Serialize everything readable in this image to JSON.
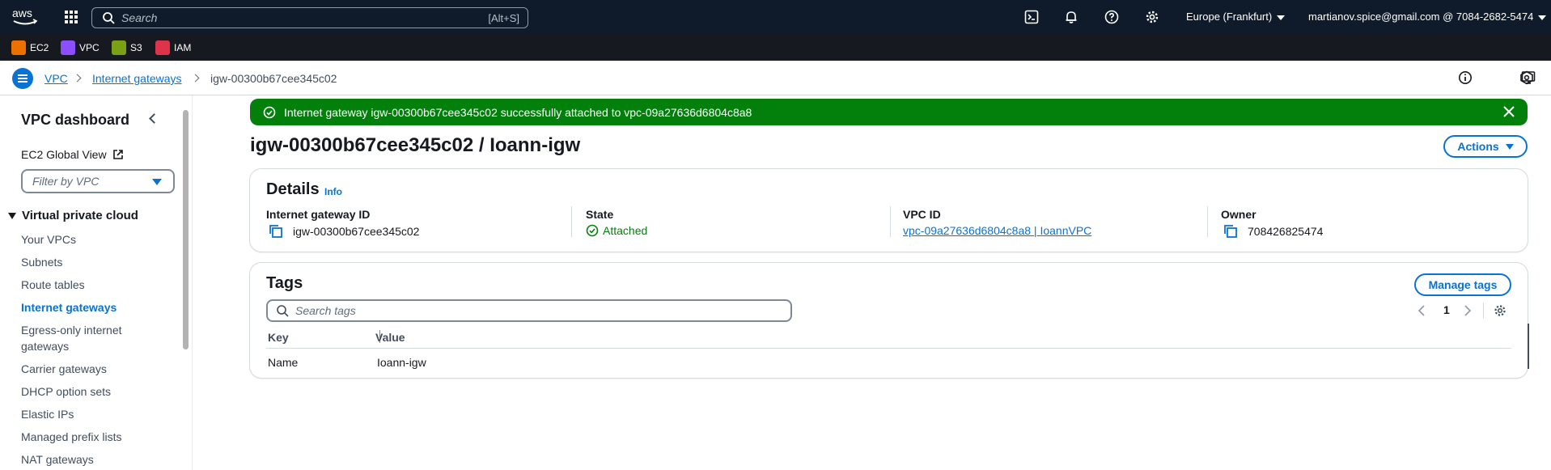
{
  "topnav": {
    "logo_text": "aws",
    "search_placeholder": "Search",
    "search_shortcut": "[Alt+S]",
    "region": "Europe (Frankfurt)",
    "account": "martianov.spice@gmail.com @ 7084-2682-5474"
  },
  "favorites": [
    {
      "label": "EC2",
      "color": "#ed7100"
    },
    {
      "label": "VPC",
      "color": "#8c4fff"
    },
    {
      "label": "S3",
      "color": "#7aa116"
    },
    {
      "label": "IAM",
      "color": "#dd344c"
    }
  ],
  "breadcrumb": {
    "items": [
      "VPC",
      "Internet gateways"
    ],
    "current": "igw-00300b67cee345c02"
  },
  "sidebar": {
    "title": "VPC dashboard",
    "ec2_global_view": "EC2 Global View",
    "filter_placeholder": "Filter by VPC",
    "section": "Virtual private cloud",
    "items": [
      "Your VPCs",
      "Subnets",
      "Route tables",
      "Internet gateways",
      "Egress-only internet",
      "gateways",
      "Carrier gateways",
      "DHCP option sets",
      "Elastic IPs",
      "Managed prefix lists",
      "NAT gateways"
    ]
  },
  "flash": {
    "message": "Internet gateway igw-00300b67cee345c02 successfully attached to vpc-09a27636d6804c8a8",
    "color": "#037f0c"
  },
  "page": {
    "title": "igw-00300b67cee345c02 / Ioann-igw",
    "actions_label": "Actions"
  },
  "details": {
    "title": "Details",
    "info": "Info",
    "igw_label": "Internet gateway ID",
    "igw_value": "igw-00300b67cee345c02",
    "state_label": "State",
    "state_value": "Attached",
    "vpc_label": "VPC ID",
    "vpc_value": "vpc-09a27636d6804c8a8 | IoannVPC",
    "owner_label": "Owner",
    "owner_value": "708426825474"
  },
  "tags": {
    "title": "Tags",
    "manage_label": "Manage tags",
    "search_placeholder": "Search tags",
    "page_number": "1",
    "col_key": "Key",
    "col_value": "Value",
    "rows": [
      {
        "key": "Name",
        "value": "Ioann-igw"
      }
    ]
  }
}
